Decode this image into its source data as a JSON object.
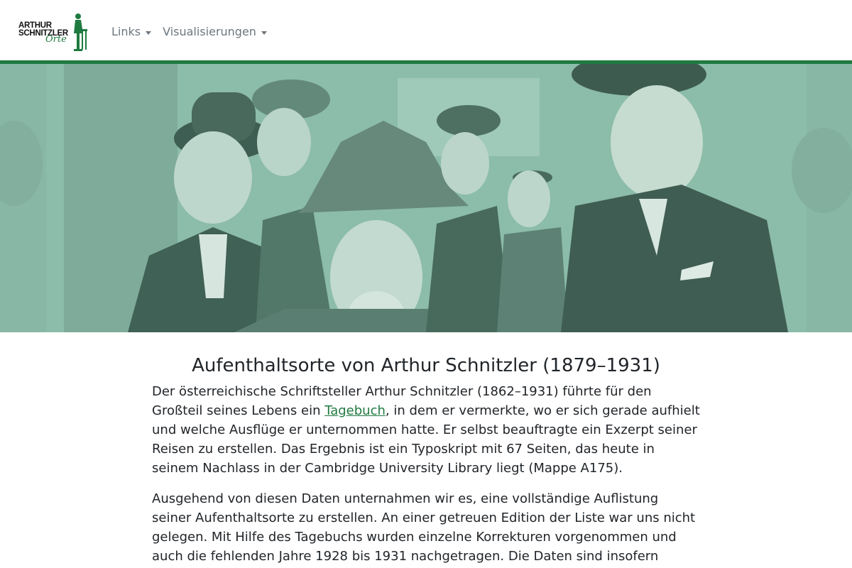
{
  "brand": {
    "line1": "ARTHUR",
    "line2": "SCHNITZLER",
    "line3": "Orte",
    "accent_color": "#1f7a40"
  },
  "nav": {
    "items": [
      {
        "label": "Links",
        "icon": "chevron-down-icon"
      },
      {
        "label": "Visualisierungen",
        "icon": "chevron-down-icon"
      }
    ]
  },
  "hero": {
    "image": "historic photograph of men in hats and coats",
    "tint_color": "#8fbfae"
  },
  "main": {
    "title": "Aufenthaltsorte von Arthur Schnitzler (1879–1931)",
    "p1_before": "Der österreichische Schriftsteller Arthur Schnitzler (1862–1931) führte für den Großteil seines Lebens ein ",
    "p1_link": "Tagebuch",
    "p1_after": ", in dem er vermerkte, wo er sich gerade aufhielt und welche Ausflüge er unternommen hatte. Er selbst beauftragte ein Exzerpt seiner Reisen zu erstellen. Das Ergebnis ist ein Typoskript mit 67 Seiten, das heute in seinem Nachlass in der Cambridge University Library liegt (Mappe A175).",
    "p2": "Ausgehend von diesen Daten unternahmen wir es, eine vollständige Auflistung seiner Aufenthaltsorte zu erstellen. An einer getreuen Edition der Liste war uns nicht gelegen. Mit Hilfe des Tagebuchs wurden einzelne Korrekturen vorgenommen und auch die fehlenden Jahre 1928 bis 1931 nachgetragen. Die Daten sind insofern"
  }
}
